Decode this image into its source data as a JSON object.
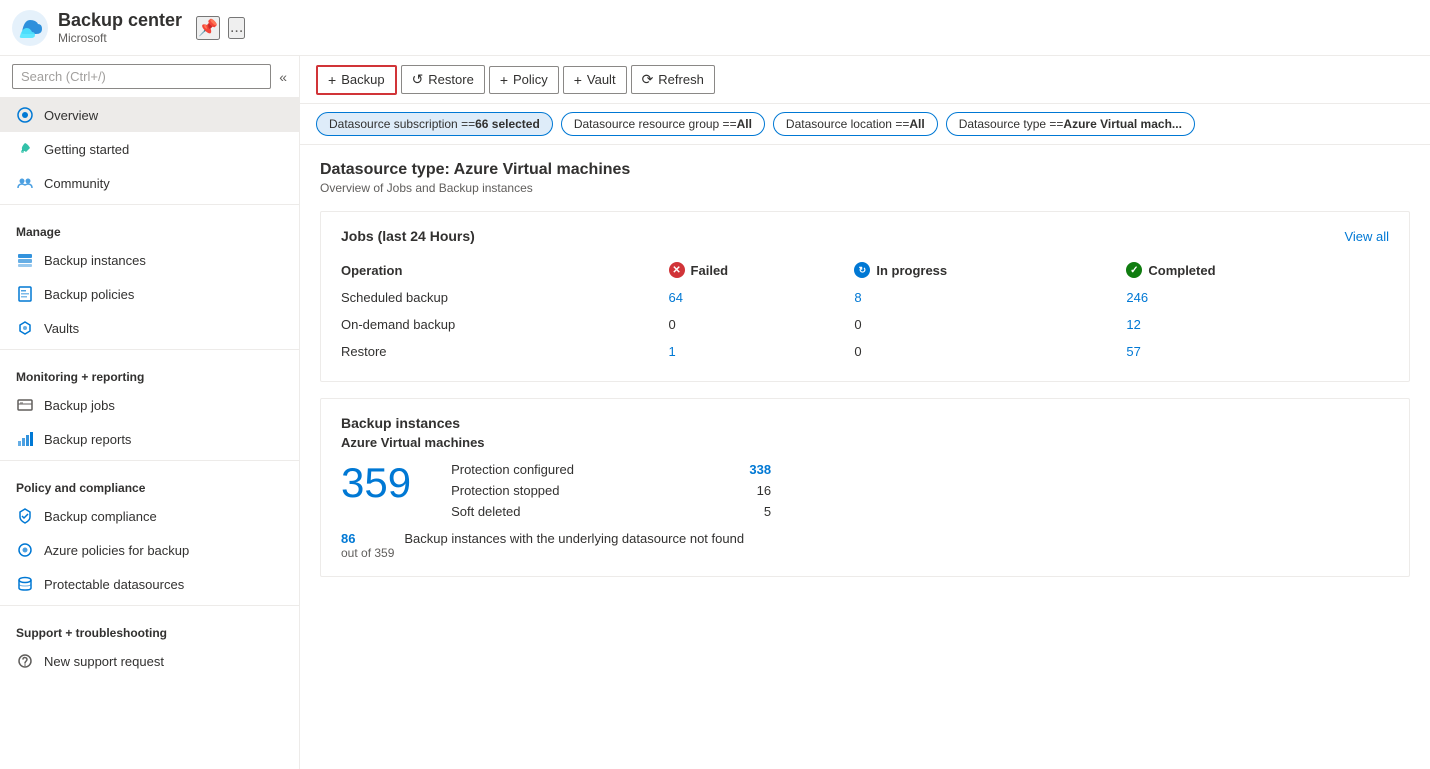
{
  "header": {
    "title": "Backup center",
    "subtitle": "Microsoft",
    "pin_label": "📌",
    "ellipsis_label": "..."
  },
  "sidebar": {
    "search_placeholder": "Search (Ctrl+/)",
    "collapse_icon": "«",
    "nav": {
      "top_items": [
        {
          "id": "overview",
          "label": "Overview",
          "active": true,
          "icon": "overview"
        },
        {
          "id": "getting-started",
          "label": "Getting started",
          "active": false,
          "icon": "rocket"
        },
        {
          "id": "community",
          "label": "Community",
          "active": false,
          "icon": "community"
        }
      ],
      "manage_section": "Manage",
      "manage_items": [
        {
          "id": "backup-instances",
          "label": "Backup instances",
          "icon": "instances"
        },
        {
          "id": "backup-policies",
          "label": "Backup policies",
          "icon": "policies"
        },
        {
          "id": "vaults",
          "label": "Vaults",
          "icon": "vaults"
        }
      ],
      "monitoring_section": "Monitoring + reporting",
      "monitoring_items": [
        {
          "id": "backup-jobs",
          "label": "Backup jobs",
          "icon": "jobs"
        },
        {
          "id": "backup-reports",
          "label": "Backup reports",
          "icon": "reports"
        }
      ],
      "policy_section": "Policy and compliance",
      "policy_items": [
        {
          "id": "backup-compliance",
          "label": "Backup compliance",
          "icon": "compliance"
        },
        {
          "id": "azure-policies",
          "label": "Azure policies for backup",
          "icon": "azure-policy"
        },
        {
          "id": "protectable-datasources",
          "label": "Protectable datasources",
          "icon": "datasources"
        }
      ],
      "support_section": "Support + troubleshooting",
      "support_items": [
        {
          "id": "new-support-request",
          "label": "New support request",
          "icon": "support"
        }
      ]
    }
  },
  "toolbar": {
    "backup_label": "Backup",
    "restore_label": "Restore",
    "policy_label": "Policy",
    "vault_label": "Vault",
    "refresh_label": "Refresh"
  },
  "filters": [
    {
      "label": "Datasource subscription == ",
      "value": "66 selected",
      "active": true
    },
    {
      "label": "Datasource resource group == ",
      "value": "All",
      "active": false
    },
    {
      "label": "Datasource location == ",
      "value": "All",
      "active": false
    },
    {
      "label": "Datasource type == ",
      "value": "Azure Virtual mach...",
      "active": false
    }
  ],
  "content": {
    "datasource_title": "Datasource type: Azure Virtual machines",
    "datasource_subtitle": "Overview of Jobs and Backup instances",
    "jobs_card": {
      "title": "Jobs (last 24 Hours)",
      "view_all": "View all",
      "columns": {
        "operation": "Operation",
        "failed": "Failed",
        "in_progress": "In progress",
        "completed": "Completed"
      },
      "rows": [
        {
          "operation": "Scheduled backup",
          "failed": "64",
          "in_progress": "8",
          "completed": "246"
        },
        {
          "operation": "On-demand backup",
          "failed": "0",
          "in_progress": "0",
          "completed": "12"
        },
        {
          "operation": "Restore",
          "failed": "1",
          "in_progress": "0",
          "completed": "57"
        }
      ]
    },
    "instances_card": {
      "title": "Backup instances",
      "vm_title": "Azure Virtual machines",
      "total": "359",
      "details": [
        {
          "label": "Protection configured",
          "value": "338",
          "is_link": true
        },
        {
          "label": "Protection stopped",
          "value": "16",
          "is_link": false
        },
        {
          "label": "Soft deleted",
          "value": "5",
          "is_link": false
        }
      ],
      "footer_number": "86",
      "footer_sub": "out of 359",
      "footer_desc": "Backup instances with the underlying datasource not found"
    }
  }
}
